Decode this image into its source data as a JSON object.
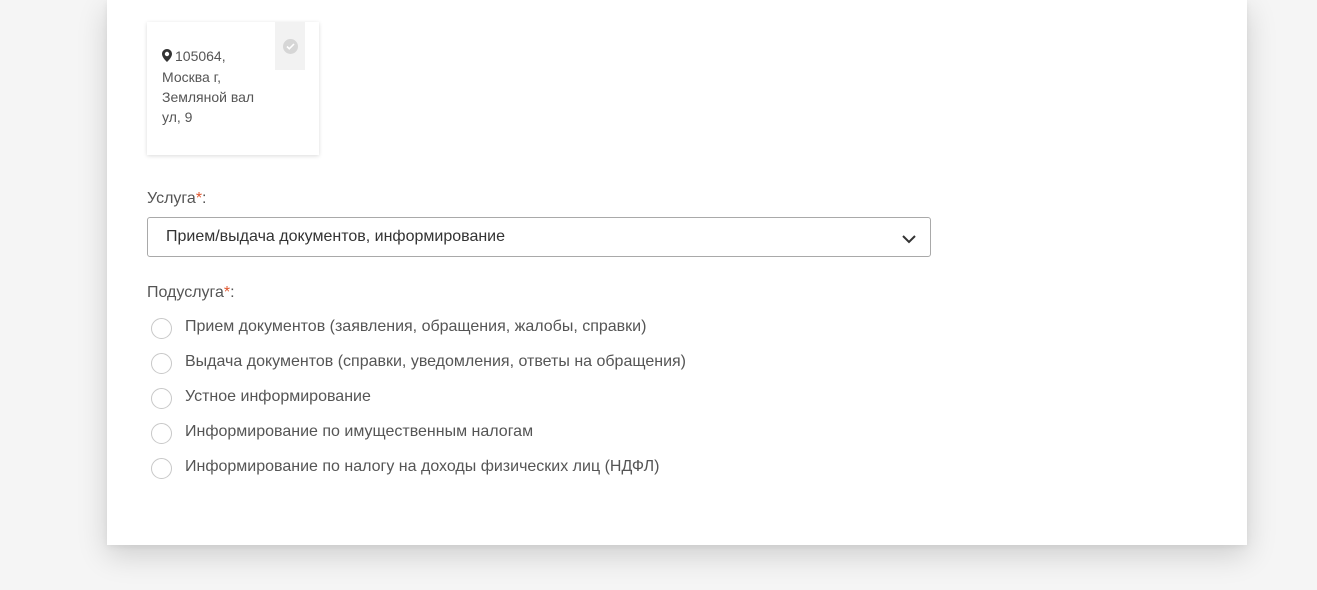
{
  "office_card": {
    "address": "105064,\nМосква г,\nЗемляной вал\nул, 9",
    "pin_icon": "map-marker-icon",
    "check_icon": "check-circle-icon"
  },
  "service": {
    "label": "Услуга",
    "required_mark": "*",
    "suffix": ":",
    "selected": "Прием/выдача документов, информирование",
    "chevron_icon": "chevron-down-icon"
  },
  "subservice": {
    "label": "Подуслуга",
    "required_mark": "*",
    "suffix": ":",
    "options": [
      "Прием документов (заявления, обращения, жалобы, справки)",
      "Выдача документов (справки, уведомления, ответы на обращения)",
      "Устное информирование",
      "Информирование по имущественным налогам",
      "Информирование по налогу на доходы физических лиц (НДФЛ)"
    ]
  },
  "colors": {
    "required": "#e0562e",
    "border": "#a9a9a9",
    "background": "#f5f5f5"
  }
}
